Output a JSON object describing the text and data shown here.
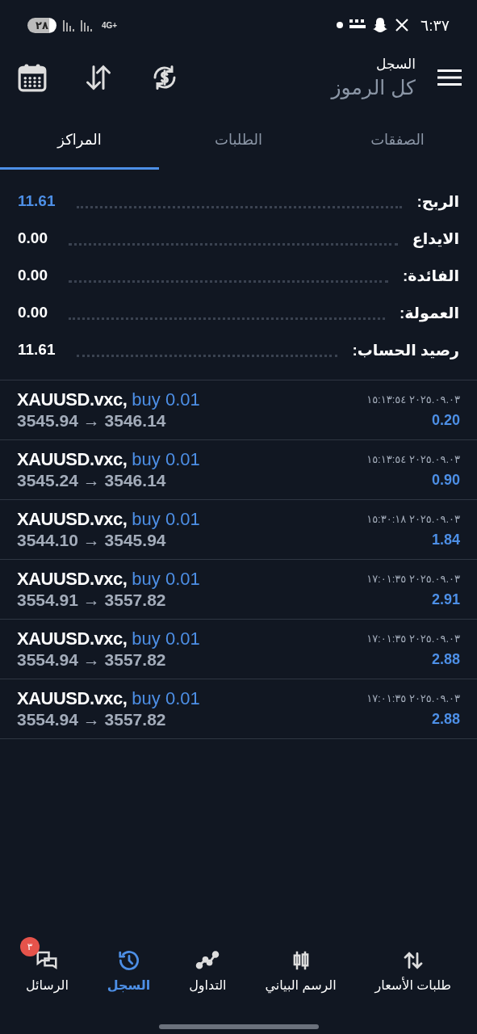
{
  "status_bar": {
    "battery": "٢٨",
    "network": "4G+",
    "time": "٦:٣٧"
  },
  "header": {
    "title": "السجل",
    "subtitle": "كل الرموز"
  },
  "tabs": [
    {
      "label": "الصفقات",
      "selected": false
    },
    {
      "label": "الطلبات",
      "selected": false
    },
    {
      "label": "المراكز",
      "selected": true
    }
  ],
  "summary": [
    {
      "label": "الربح:",
      "value": "11.61",
      "highlight": true
    },
    {
      "label": "الايداع",
      "value": "0.00",
      "highlight": false
    },
    {
      "label": "الفائدة:",
      "value": "0.00",
      "highlight": false
    },
    {
      "label": "العمولة:",
      "value": "0.00",
      "highlight": false
    },
    {
      "label": "رصيد الحساب:",
      "value": "11.61",
      "highlight": false
    }
  ],
  "trades": [
    {
      "symbol": "XAUUSD.vxc,",
      "side": "buy 0.01",
      "prices": "3545.94 → 3546.14",
      "time": "٢٠٢٥.٠٩.٠٣ ١٥:١٣:٥٤",
      "profit": "0.20"
    },
    {
      "symbol": "XAUUSD.vxc,",
      "side": "buy 0.01",
      "prices": "3545.24 → 3546.14",
      "time": "٢٠٢٥.٠٩.٠٣ ١٥:١٣:٥٤",
      "profit": "0.90"
    },
    {
      "symbol": "XAUUSD.vxc,",
      "side": "buy 0.01",
      "prices": "3544.10 → 3545.94",
      "time": "٢٠٢٥.٠٩.٠٣ ١٥:٣٠:١٨",
      "profit": "1.84"
    },
    {
      "symbol": "XAUUSD.vxc,",
      "side": "buy 0.01",
      "prices": "3554.91 → 3557.82",
      "time": "٢٠٢٥.٠٩.٠٣ ١٧:٠١:٣٥",
      "profit": "2.91"
    },
    {
      "symbol": "XAUUSD.vxc,",
      "side": "buy 0.01",
      "prices": "3554.94 → 3557.82",
      "time": "٢٠٢٥.٠٩.٠٣ ١٧:٠١:٣٥",
      "profit": "2.88"
    },
    {
      "symbol": "XAUUSD.vxc,",
      "side": "buy 0.01",
      "prices": "3554.94 → 3557.82",
      "time": "٢٠٢٥.٠٩.٠٣ ١٧:٠١:٣٥",
      "profit": "2.88"
    }
  ],
  "bottom_nav": [
    {
      "label": "طلبات الأسعار",
      "kind": "quotes",
      "selected": false
    },
    {
      "label": "الرسم البياني",
      "kind": "chart",
      "selected": false
    },
    {
      "label": "التداول",
      "kind": "trade",
      "selected": false
    },
    {
      "label": "السجل",
      "kind": "history",
      "selected": true
    },
    {
      "label": "الرسائل",
      "kind": "messages",
      "selected": false,
      "badge": "٣"
    }
  ]
}
